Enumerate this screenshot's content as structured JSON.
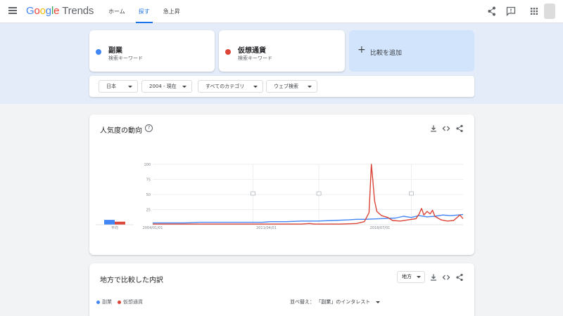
{
  "header": {
    "logo_letters": [
      "G",
      "o",
      "o",
      "g",
      "l",
      "e"
    ],
    "logo_product": "Trends",
    "nav": [
      {
        "label": "ホーム",
        "active": false
      },
      {
        "label": "探す",
        "active": true
      },
      {
        "label": "急上昇",
        "active": false
      }
    ],
    "icons": [
      "menu-icon",
      "share-icon",
      "feedback-icon",
      "apps-icon"
    ]
  },
  "comparison": {
    "terms": [
      {
        "name": "副業",
        "subtitle": "検索キーワード",
        "color": "#4285f4"
      },
      {
        "name": "仮想通貨",
        "subtitle": "検索キーワード",
        "color": "#db4437"
      }
    ],
    "add_plus": "+",
    "add_label": "比較を追加"
  },
  "filters": [
    {
      "label": "日本"
    },
    {
      "label": "2004 - 現在"
    },
    {
      "label": "すべてのカテゴリ"
    },
    {
      "label": "ウェブ検索"
    }
  ],
  "interest_card": {
    "title": "人気度の動向",
    "help": "?",
    "icons": [
      "download-icon",
      "embed-icon",
      "share-icon"
    ]
  },
  "region_card": {
    "title": "地方で比較した内訳",
    "dropdown": "地方",
    "icons": [
      "download-icon",
      "embed-icon",
      "share-icon"
    ],
    "legend": [
      {
        "name": "副業",
        "color": "#4285f4"
      },
      {
        "name": "仮想通貨",
        "color": "#db4437"
      }
    ],
    "sort_label": "並べ替え：",
    "sort_value": "「副業」のインタレスト"
  },
  "chart_data": {
    "type": "line",
    "ylim": [
      0,
      100
    ],
    "y_ticks": [
      100,
      75,
      50,
      25
    ],
    "x_labels": [
      {
        "label": "2004/01/01",
        "year": 2004.0
      },
      {
        "label": "2011/04/01",
        "year": 2011.25
      },
      {
        "label": "2018/07/01",
        "year": 2018.5
      }
    ],
    "x_range": [
      2004.0,
      2023.8
    ],
    "gridline_years": [
      2010.4,
      2014.6,
      2020.5
    ],
    "annotation_years": [
      2010.4,
      2014.6,
      2020.5
    ],
    "averages": {
      "label": "平均",
      "values": [
        {
          "name": "副業",
          "value": 8
        },
        {
          "name": "仮想通貨",
          "value": 5
        }
      ]
    },
    "series": [
      {
        "name": "副業",
        "color": "#4285f4",
        "points": [
          [
            2004.0,
            3
          ],
          [
            2005.0,
            3
          ],
          [
            2006.0,
            3
          ],
          [
            2007.0,
            4
          ],
          [
            2008.0,
            4
          ],
          [
            2009.0,
            4
          ],
          [
            2010.0,
            4
          ],
          [
            2011.0,
            4
          ],
          [
            2011.5,
            5
          ],
          [
            2012.5,
            5
          ],
          [
            2013.5,
            6
          ],
          [
            2014.5,
            6
          ],
          [
            2015.5,
            7
          ],
          [
            2016.5,
            8
          ],
          [
            2017.0,
            9
          ],
          [
            2017.5,
            9
          ],
          [
            2018.5,
            10
          ],
          [
            2019.5,
            11
          ],
          [
            2020.0,
            14
          ],
          [
            2020.5,
            12
          ],
          [
            2021.0,
            15
          ],
          [
            2021.5,
            13
          ],
          [
            2022.0,
            14
          ],
          [
            2022.5,
            16
          ],
          [
            2023.0,
            15
          ],
          [
            2023.5,
            16
          ],
          [
            2023.8,
            17
          ]
        ]
      },
      {
        "name": "仮想通貨",
        "color": "#db4437",
        "points": [
          [
            2004.0,
            1
          ],
          [
            2008.0,
            1
          ],
          [
            2013.5,
            1
          ],
          [
            2014.0,
            2
          ],
          [
            2014.3,
            1
          ],
          [
            2016.0,
            1
          ],
          [
            2017.0,
            2
          ],
          [
            2017.5,
            5
          ],
          [
            2017.8,
            20
          ],
          [
            2017.95,
            100
          ],
          [
            2018.05,
            72
          ],
          [
            2018.15,
            40
          ],
          [
            2018.3,
            22
          ],
          [
            2018.6,
            15
          ],
          [
            2019.0,
            12
          ],
          [
            2019.3,
            7
          ],
          [
            2019.8,
            6
          ],
          [
            2020.3,
            8
          ],
          [
            2020.8,
            10
          ],
          [
            2021.0,
            18
          ],
          [
            2021.15,
            27
          ],
          [
            2021.3,
            16
          ],
          [
            2021.5,
            22
          ],
          [
            2021.7,
            18
          ],
          [
            2021.85,
            24
          ],
          [
            2022.0,
            14
          ],
          [
            2022.4,
            8
          ],
          [
            2022.8,
            6
          ],
          [
            2023.2,
            7
          ],
          [
            2023.6,
            16
          ],
          [
            2023.8,
            10
          ]
        ]
      }
    ]
  }
}
